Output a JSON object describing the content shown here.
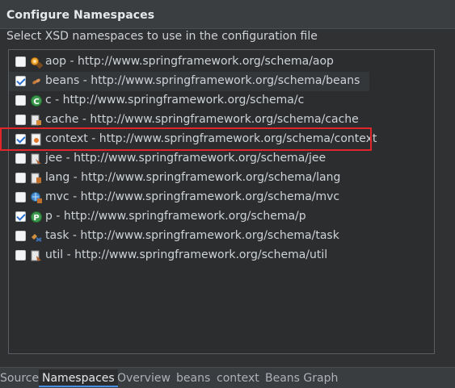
{
  "section": {
    "title": "Configure Namespaces",
    "description": "Select XSD namespaces to use in the configuration file"
  },
  "namespaces": [
    {
      "label": "aop - http://www.springframework.org/schema/aop",
      "checked": false,
      "icon": "aop-icon"
    },
    {
      "label": "beans - http://www.springframework.org/schema/beans",
      "checked": true,
      "icon": "beans-icon"
    },
    {
      "label": "c - http://www.springframework.org/schema/c",
      "checked": false,
      "icon": "c-icon"
    },
    {
      "label": "cache - http://www.springframework.org/schema/cache",
      "checked": false,
      "icon": "cache-icon"
    },
    {
      "label": "context - http://www.springframework.org/schema/context",
      "checked": true,
      "icon": "context-icon"
    },
    {
      "label": "jee - http://www.springframework.org/schema/jee",
      "checked": false,
      "icon": "jee-icon"
    },
    {
      "label": "lang - http://www.springframework.org/schema/lang",
      "checked": false,
      "icon": "lang-icon"
    },
    {
      "label": "mvc - http://www.springframework.org/schema/mvc",
      "checked": false,
      "icon": "mvc-icon"
    },
    {
      "label": "p - http://www.springframework.org/schema/p",
      "checked": true,
      "icon": "p-icon"
    },
    {
      "label": "task - http://www.springframework.org/schema/task",
      "checked": false,
      "icon": "task-icon"
    },
    {
      "label": "util - http://www.springframework.org/schema/util",
      "checked": false,
      "icon": "util-icon"
    }
  ],
  "tabs": [
    {
      "label": "Source",
      "active": false
    },
    {
      "label": "Namespaces",
      "active": true
    },
    {
      "label": "Overview",
      "active": false
    },
    {
      "label": "beans",
      "active": false
    },
    {
      "label": "context",
      "active": false
    },
    {
      "label": "Beans Graph",
      "active": false
    }
  ],
  "colors": {
    "highlight_border": "#e0252b",
    "checkmark": "#2a6fd1",
    "active_tab_accent": "#4a90e2"
  }
}
